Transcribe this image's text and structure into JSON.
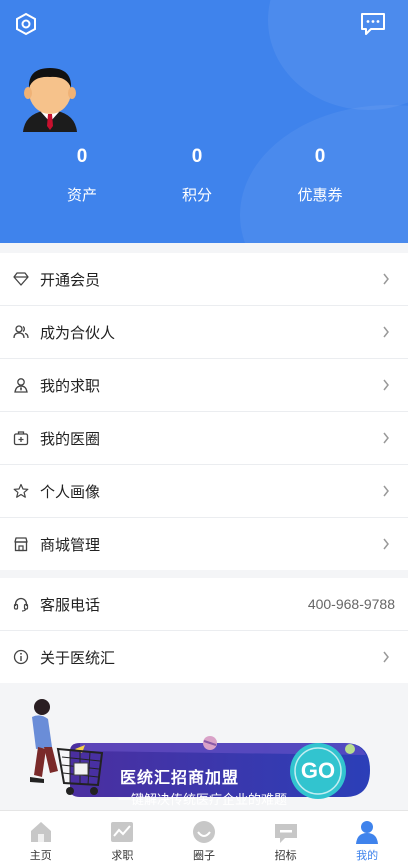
{
  "header": {
    "settings_icon": "settings-hexagon-icon",
    "message_icon": "chat-message-icon",
    "avatar_icon": "businessman-avatar",
    "stats": [
      {
        "value": "0",
        "label": "资产"
      },
      {
        "value": "0",
        "label": "积分"
      },
      {
        "value": "0",
        "label": "优惠券"
      }
    ]
  },
  "menu_group1": [
    {
      "label": "开通会员",
      "icon": "diamond-icon"
    },
    {
      "label": "成为合伙人",
      "icon": "partner-icon"
    },
    {
      "label": "我的求职",
      "icon": "job-seeker-icon"
    },
    {
      "label": "我的医圈",
      "icon": "medical-box-icon"
    },
    {
      "label": "个人画像",
      "icon": "star-icon"
    },
    {
      "label": "商城管理",
      "icon": "store-icon"
    }
  ],
  "menu_group2": [
    {
      "label": "客服电话",
      "icon": "headset-icon",
      "value": "400-968-9788"
    },
    {
      "label": "关于医统汇",
      "icon": "info-icon"
    }
  ],
  "banner": {
    "title": "医统汇招商加盟",
    "subtitle": "一键解决传统医疗企业的难题",
    "go_label": "GO"
  },
  "tabbar": [
    {
      "label": "主页",
      "icon": "home-icon"
    },
    {
      "label": "求职",
      "icon": "job-chart-icon"
    },
    {
      "label": "圈子",
      "icon": "circle-icon"
    },
    {
      "label": "招标",
      "icon": "bidding-icon"
    },
    {
      "label": "我的",
      "icon": "profile-icon",
      "active": true
    }
  ],
  "colors": {
    "primary": "#3f83ec",
    "banner_dark": "#3a2a9a",
    "go_teal": "#32c4cf"
  }
}
